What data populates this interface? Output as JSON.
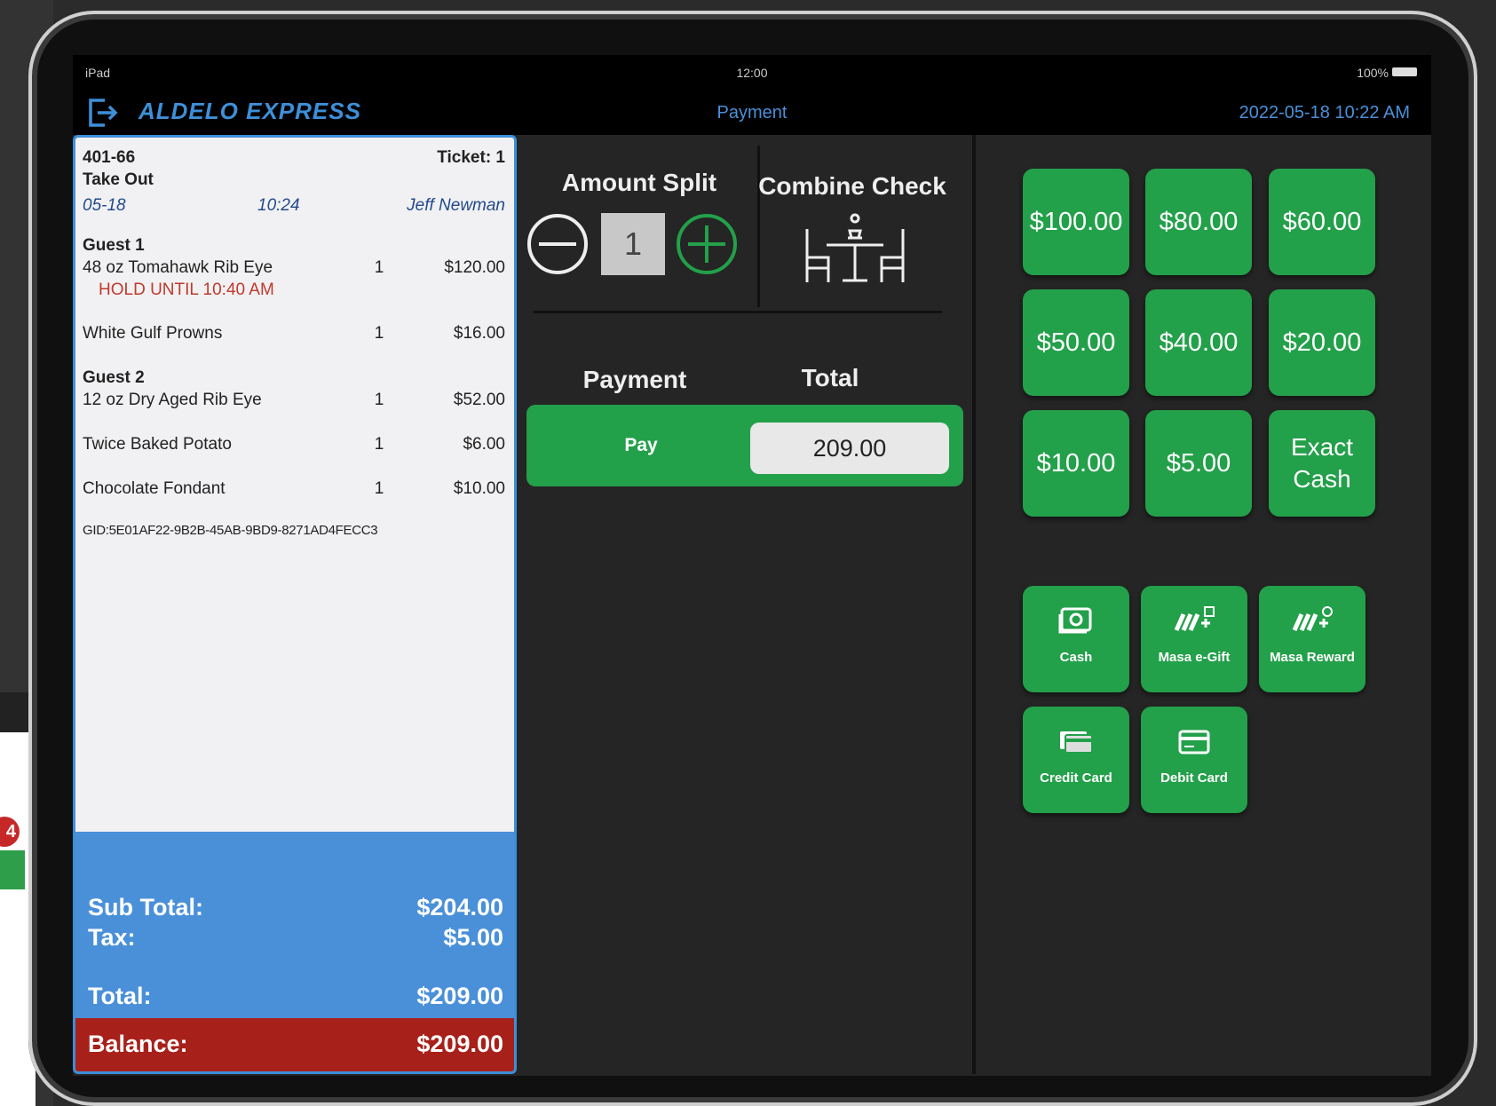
{
  "status_bar": {
    "device": "iPad",
    "time": "12:00",
    "battery": "100%"
  },
  "header": {
    "brand": "ALDELO EXPRESS",
    "title": "Payment",
    "datetime": "2022-05-18 10:22 AM"
  },
  "background_phone": {
    "badge": "4"
  },
  "ticket": {
    "order_no": "401-66",
    "ticket_label": "Ticket: 1",
    "order_type": "Take Out",
    "date": "05-18",
    "time": "10:24",
    "server": "Jeff Newman",
    "guest1": "Guest 1",
    "guest2": "Guest 2",
    "items": [
      {
        "name": "48 oz Tomahawk Rib Eye",
        "qty": "1",
        "price": "$120.00",
        "note": "HOLD UNTIL 10:40 AM"
      },
      {
        "name": "White Gulf Prowns",
        "qty": "1",
        "price": "$16.00"
      },
      {
        "name": "12 oz Dry Aged Rib Eye",
        "qty": "1",
        "price": "$52.00"
      },
      {
        "name": "Twice Baked Potato",
        "qty": "1",
        "price": "$6.00"
      },
      {
        "name": "Chocolate Fondant",
        "qty": "1",
        "price": "$10.00"
      }
    ],
    "gid": "GID:5E01AF22-9B2B-45AB-9BD9-8271AD4FECC3"
  },
  "totals": {
    "subtotal_label": "Sub Total:",
    "subtotal": "$204.00",
    "tax_label": "Tax:",
    "tax": "$5.00",
    "total_label": "Total:",
    "total": "$209.00",
    "balance_label": "Balance:",
    "balance": "$209.00"
  },
  "split": {
    "label": "Amount Split",
    "count": "1",
    "combine_label": "Combine Check"
  },
  "payment": {
    "payment_col": "Payment",
    "total_col": "Total",
    "pay_button": "Pay",
    "total_value": "209.00"
  },
  "amounts": [
    "$100.00",
    "$80.00",
    "$60.00",
    "$50.00",
    "$40.00",
    "$20.00",
    "$10.00",
    "$5.00"
  ],
  "exact_cash": {
    "line1": "Exact",
    "line2": "Cash"
  },
  "tenders": {
    "cash": "Cash",
    "egift": "Masa e-Gift",
    "reward": "Masa Reward",
    "credit": "Credit Card",
    "debit": "Debit Card"
  },
  "colors": {
    "accent_green": "#23a04a",
    "accent_blue": "#3b8fd9",
    "balance_red": "#a8201a",
    "hold_red": "#c0392b"
  }
}
